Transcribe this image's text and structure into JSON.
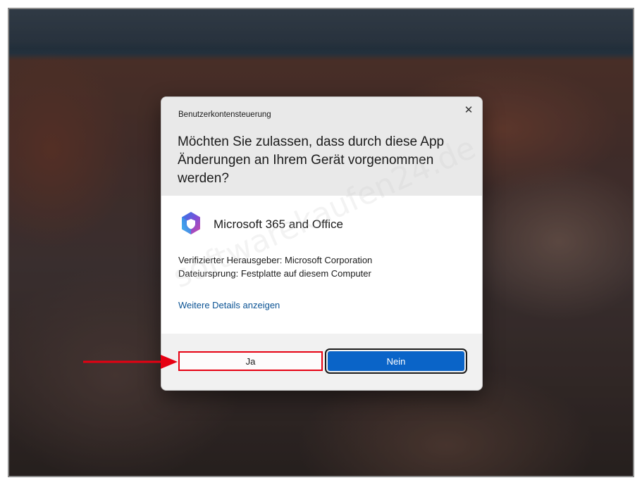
{
  "dialog": {
    "title": "Benutzerkontensteuerung",
    "close_glyph": "✕",
    "question": "Möchten Sie zulassen, dass durch diese App Änderungen an Ihrem Gerät vorgenommen werden?",
    "app_name": "Microsoft 365 and Office",
    "publisher": "Verifizierter Herausgeber: Microsoft Corporation",
    "origin": "Dateiursprung: Festplatte auf diesem Computer",
    "details_link": "Weitere Details anzeigen",
    "yes_label": "Ja",
    "no_label": "Nein"
  },
  "watermark": "softwarekaufen24.de",
  "icons": {
    "app": "microsoft-365-icon",
    "close": "close-icon",
    "annotation": "red-arrow-icon"
  },
  "colors": {
    "link": "#0b5394",
    "primary_button": "#0a64c8",
    "highlight": "#e60012"
  }
}
